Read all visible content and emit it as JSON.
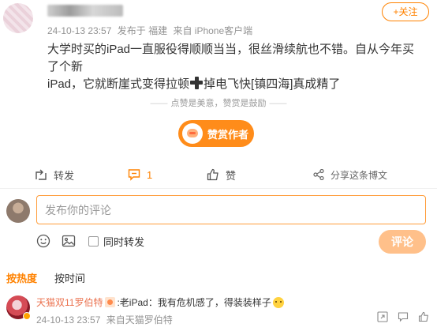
{
  "post": {
    "timestamp": "24-10-13 23:57",
    "location": "发布于 福建",
    "source": "来自 iPhone客户端",
    "follow_label": "+关注",
    "text_line1": "大学时买的iPad一直服役得顺顺当当，很丝滑续航也不错。自从今年买了个新",
    "text_line2_a": "iPad，它就断崖式变得拉顿",
    "text_line2_b": "掉电飞快[镇四海]真成精了"
  },
  "reward": {
    "hint": "点赞是美意，赞赏是鼓励",
    "dash": "——",
    "button_label": "赞赏作者"
  },
  "actions": {
    "repost_label": "转发",
    "comment_count": "1",
    "like_label": "赞",
    "share_label": "分享这条博文"
  },
  "comment_box": {
    "placeholder": "发布你的评论",
    "repost_check_label": "同时转发",
    "submit_label": "评论"
  },
  "sort": {
    "hot_label": "按热度",
    "time_label": "按时间"
  },
  "comments": [
    {
      "user": "天猫双11罗伯特",
      "text": ":老iPad：我有危机感了，得装装样子",
      "timestamp": "24-10-13 23:57",
      "source": "来自天猫罗伯特"
    }
  ],
  "colors": {
    "accent": "#ff8200",
    "reward": "#ff8c1a",
    "submit_disabled": "#ffc08a",
    "username": "#eb7350"
  },
  "icons": [
    "cross-emoji",
    "repost-icon",
    "comment-icon",
    "like-icon",
    "share-icon",
    "image-icon",
    "emoji-icon",
    "thumb-icon",
    "reply-icon"
  ]
}
